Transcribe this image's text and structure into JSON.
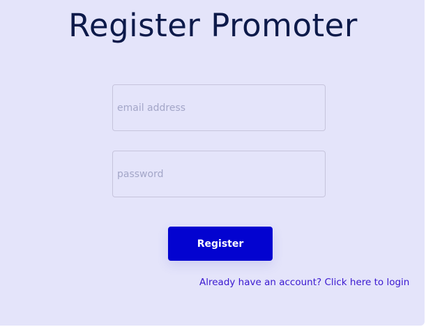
{
  "page": {
    "title": "Register Promoter"
  },
  "form": {
    "email": {
      "value": "",
      "placeholder": "email address"
    },
    "password": {
      "value": "",
      "placeholder": "password"
    },
    "submit_label": "Register",
    "login_link": "Already have an account? Click here to login"
  },
  "colors": {
    "background": "#e4e4fa",
    "primary": "#0303d0",
    "title": "#0d1a4a",
    "link": "#3a18d0"
  }
}
